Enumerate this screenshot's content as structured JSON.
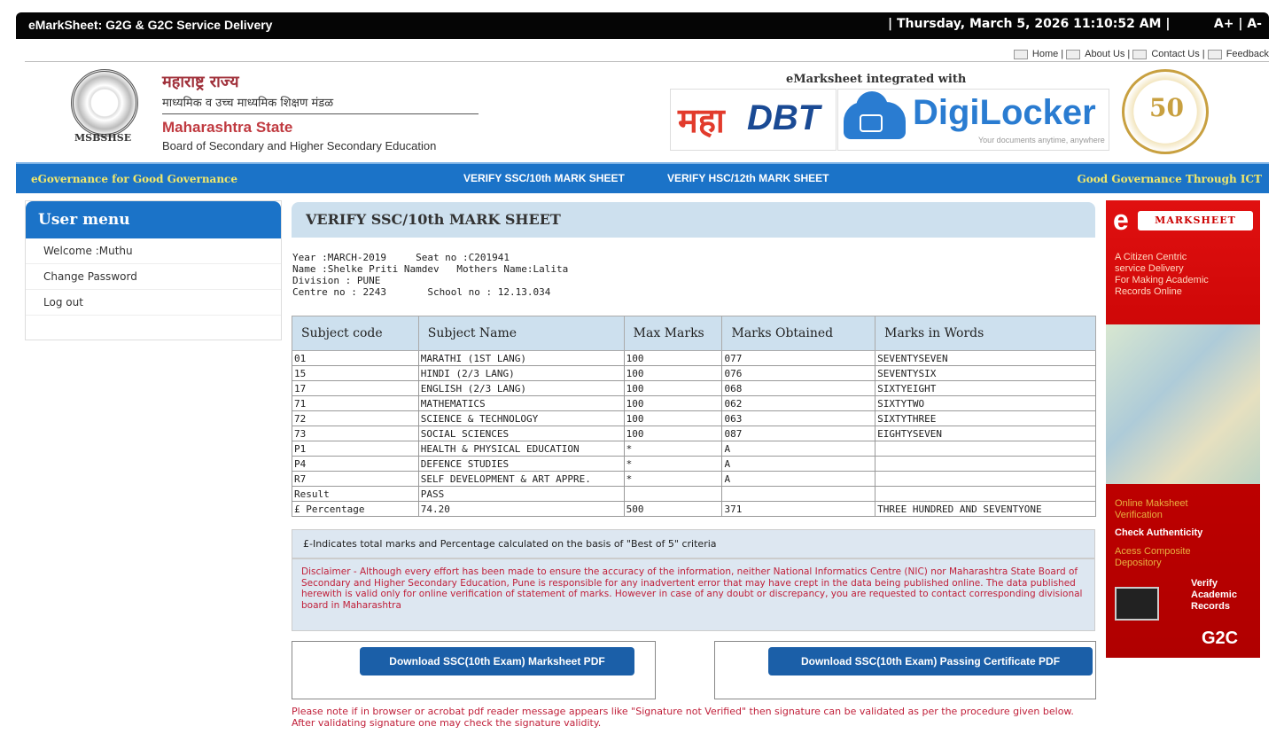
{
  "topbar": {
    "title": "eMarkSheet: G2G & G2C Service Delivery",
    "datetime": "| Thursday, March 5, 2026 11:10:52 AM |",
    "font_increase": "A+",
    "font_sep": " | ",
    "font_decrease": "A-"
  },
  "toplinks": {
    "home": "Home",
    "about": "About Us",
    "contact": "Contact Us",
    "feedback": "Feedback",
    "sep": "|"
  },
  "header": {
    "seal_caption": "MSBSHSE",
    "org_marathi_1": "महाराष्ट्र राज्य",
    "org_marathi_2": "माध्यमिक व उच्च माध्यमिक शिक्षण मंडळ",
    "org_en_1": "Maharashtra State",
    "org_en_2": "Board of Secondary and Higher Secondary Education",
    "integrated": "eMarksheet integrated with",
    "mahadbt_a": "महा",
    "mahadbt_b": "DBT",
    "digilocker": "DigiLocker",
    "digilocker_tag": "Your documents anytime, anywhere",
    "seal50": "50"
  },
  "nav": {
    "left_slogan": "eGovernance for Good Governance",
    "verify_ssc": "VERIFY SSC/10th MARK SHEET",
    "verify_hsc": "VERIFY HSC/12th MARK SHEET",
    "right_slogan": "Good Governance Through ICT"
  },
  "user_menu": {
    "title": "User menu",
    "welcome": "Welcome :Muthu",
    "change_password": "Change Password",
    "logout": "Log out"
  },
  "panel": {
    "title": "VERIFY SSC/10th MARK SHEET",
    "line1": "Year :MARCH-2019     Seat no :C201941",
    "line2": "Name :Shelke Priti Namdev   Mothers Name:Lalita",
    "line3": "Division : PUNE",
    "line4": "Centre no : 2243       School no : 12.13.034"
  },
  "table": {
    "headers": [
      "Subject code",
      "Subject Name",
      "Max Marks",
      "Marks Obtained",
      "Marks in Words"
    ],
    "rows": [
      [
        "01",
        "MARATHI (1ST LANG)",
        "100",
        "077",
        "SEVENTYSEVEN"
      ],
      [
        "15",
        "HINDI (2/3 LANG)",
        "100",
        "076",
        "SEVENTYSIX"
      ],
      [
        "17",
        "ENGLISH (2/3 LANG)",
        "100",
        "068",
        "SIXTYEIGHT"
      ],
      [
        "71",
        "MATHEMATICS",
        "100",
        "062",
        "SIXTYTWO"
      ],
      [
        "72",
        "SCIENCE & TECHNOLOGY",
        "100",
        "063",
        "SIXTYTHREE"
      ],
      [
        "73",
        "SOCIAL SCIENCES",
        "100",
        "087",
        "EIGHTYSEVEN"
      ],
      [
        "P1",
        "HEALTH & PHYSICAL EDUCATION",
        "*",
        "A",
        ""
      ],
      [
        "P4",
        "DEFENCE STUDIES",
        "*",
        "A",
        ""
      ],
      [
        "R7",
        "SELF DEVELOPMENT & ART APPRE.",
        "*",
        "A",
        ""
      ],
      [
        "Result",
        "PASS",
        "",
        "",
        ""
      ],
      [
        "£ Percentage",
        "74.20",
        "500",
        "371",
        "THREE HUNDRED AND SEVENTYONE"
      ]
    ]
  },
  "note": "£-Indicates total marks and Percentage calculated on the basis of \"Best of 5\" criteria",
  "disclaimer": "Disclaimer - Although every effort has been made to ensure the accuracy of the information, neither National Informatics Centre (NIC) nor Maharashtra State Board of Secondary and Higher Secondary Education, Pune is responsible for any inadvertent error that may have crept in the data being published online. The data published herewith is valid only for online verification of statement of marks. However in case of any doubt or discrepancy, you are requested to contact corresponding divisional board in Maharashtra",
  "downloads": {
    "marksheet": "Download SSC(10th Exam) Marksheet PDF",
    "certificate": "Download SSC(10th Exam) Passing Certificate PDF"
  },
  "signature_note": "Please note if in browser or acrobat pdf reader message appears like \"Signature not Verified\" then signature can be validated as per the procedure given below. After validating signature one may check the signature validity.",
  "banner": {
    "e": "e",
    "logo_text": "MARKSHEET",
    "line1": "A Citizen Centric",
    "line2": "service Delivery",
    "line3": "For Making Academic",
    "line4": "Records Online",
    "online_1": "Online Maksheet",
    "online_2": "Verification",
    "check": "Check Authenticity",
    "access_1": "Acess Composite",
    "access_2": "Depository",
    "verify_1": "Verify",
    "verify_2": "Academic",
    "verify_3": "Records",
    "g2c": "G2C"
  },
  "colors": {
    "nav_blue": "#1b73c8",
    "panel_blue": "#cde0ee",
    "banner_red": "#c00000",
    "disclaimer_red": "#c0203a"
  }
}
